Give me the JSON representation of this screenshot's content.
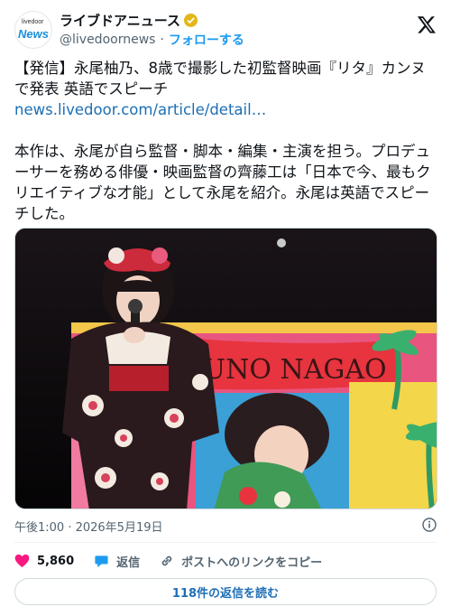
{
  "account": {
    "avatar_top": "livedoor",
    "avatar_bottom": "News",
    "name": "ライブドアニュース",
    "handle": "@livedoornews",
    "separator": "·",
    "follow": "フォローする"
  },
  "tweet": {
    "headline": "【発信】永尾柚乃、8歳で撮影した初監督映画『リタ』カンヌで発表 英語でスピーチ",
    "link": "news.livedoor.com/article/detail…",
    "body": "本作は、永尾が自ら監督・脚本・編集・主演を担う。プロデューサーを務める俳優・映画監督の齊藤工は「日本で今、最もクリエイティブな才能」として永尾を紹介。永尾は英語でスピーチした。",
    "banner_text": "YUNO NAGAO"
  },
  "meta": {
    "timestamp": "午後1:00 · 2026年5月19日"
  },
  "actions": {
    "likes": "5,860",
    "reply": "返信",
    "copy_link": "ポストへのリンクをコピー"
  },
  "replies_button": "118件の返信を読む",
  "colors": {
    "accent": "#1d9bf0",
    "like": "#f91880",
    "verified": "#e2b719"
  }
}
